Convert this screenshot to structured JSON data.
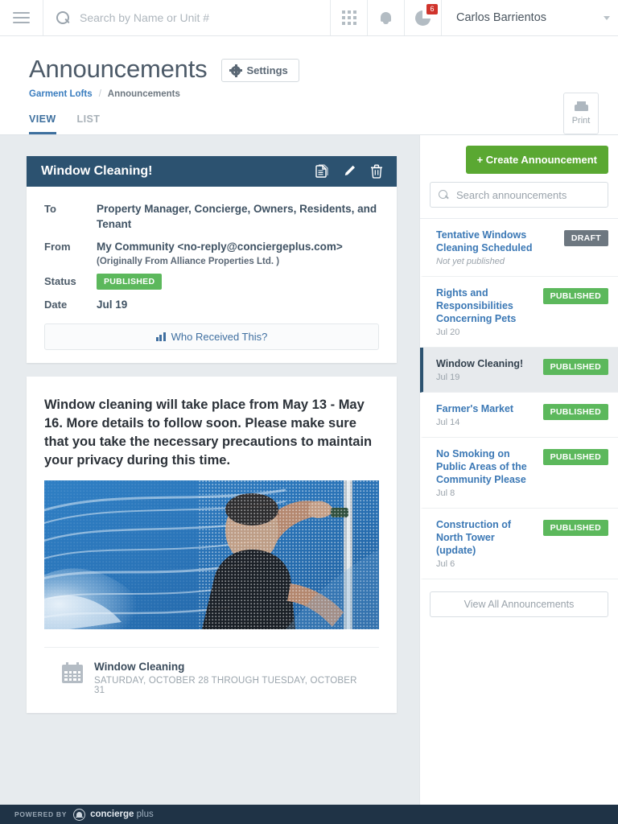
{
  "topbar": {
    "menu_icon": "hamburger-icon",
    "search": {
      "placeholder": "Search by Name or Unit #",
      "value": ""
    },
    "apps_icon": "grid-apps-icon",
    "notifications_icon": "bell-icon",
    "activity_icon": "pie-chart-icon",
    "activity_badge": "6",
    "user_name": "Carlos Barrientos"
  },
  "page": {
    "title": "Announcements",
    "settings_label": "Settings",
    "print_label": "Print",
    "breadcrumb": {
      "parent": "Garment Lofts",
      "separator": "/",
      "current": "Announcements"
    },
    "tabs": [
      {
        "label": "VIEW",
        "active": true
      },
      {
        "label": "LIST",
        "active": false
      }
    ]
  },
  "announcement": {
    "title": "Window Cleaning!",
    "actions": [
      "copy-icon",
      "edit-pencil-icon",
      "delete-trash-icon"
    ],
    "meta": {
      "to_label": "To",
      "to_value": "Property Manager, Concierge, Owners, Residents, and Tenant",
      "from_label": "From",
      "from_value": "My Community <no-reply@conciergeplus.com>",
      "from_sub": "(Originally From Alliance Properties Ltd. )",
      "status_label": "Status",
      "status_value": "PUBLISHED",
      "date_label": "Date",
      "date_value": "Jul 19"
    },
    "who_received_label": "Who Received This?",
    "body_text": "Window cleaning will take place from May 13 - May 16. More details to follow soon. Please make sure that you take the necessary precautions to maintain your privacy during this time.",
    "image_alt": "person-cleaning-window-photo",
    "event": {
      "icon": "calendar-icon",
      "title": "Window Cleaning",
      "range": "SATURDAY, OCTOBER 28 THROUGH TUESDAY, OCTOBER 31"
    }
  },
  "sidebar": {
    "create_label": "+ Create Announcement",
    "search_placeholder": "Search announcements",
    "search_value": "",
    "view_all_label": "View All Announcements",
    "items": [
      {
        "title": "Tentative Windows Cleaning Scheduled",
        "date": "Not yet published",
        "date_italic": true,
        "status": "DRAFT",
        "status_kind": "draft",
        "active": false
      },
      {
        "title": "Rights and Responsibilities Concerning Pets",
        "date": "Jul 20",
        "date_italic": false,
        "status": "PUBLISHED",
        "status_kind": "published",
        "active": false
      },
      {
        "title": "Window Cleaning!",
        "date": "Jul 19",
        "date_italic": false,
        "status": "PUBLISHED",
        "status_kind": "published",
        "active": true
      },
      {
        "title": "Farmer's Market",
        "date": "Jul 14",
        "date_italic": false,
        "status": "PUBLISHED",
        "status_kind": "published",
        "active": false
      },
      {
        "title": "No Smoking on Public Areas of the Community Please",
        "date": "Jul 8",
        "date_italic": false,
        "status": "PUBLISHED",
        "status_kind": "published",
        "active": false
      },
      {
        "title": "Construction of North Tower (update)",
        "date": "Jul 6",
        "date_italic": false,
        "status": "PUBLISHED",
        "status_kind": "published",
        "active": false
      }
    ]
  },
  "footer": {
    "powered_by": "POWERED BY",
    "brand": "concierge",
    "brand_suffix": " plus"
  },
  "colors": {
    "card_header": "#2c5270",
    "published": "#5cb85c",
    "draft": "#6d7780",
    "create_green": "#5aa832",
    "link_blue": "#3b78b5",
    "badge_red": "#d0342c",
    "page_bg": "#e7ebee",
    "footer_bg": "#1f3346"
  }
}
